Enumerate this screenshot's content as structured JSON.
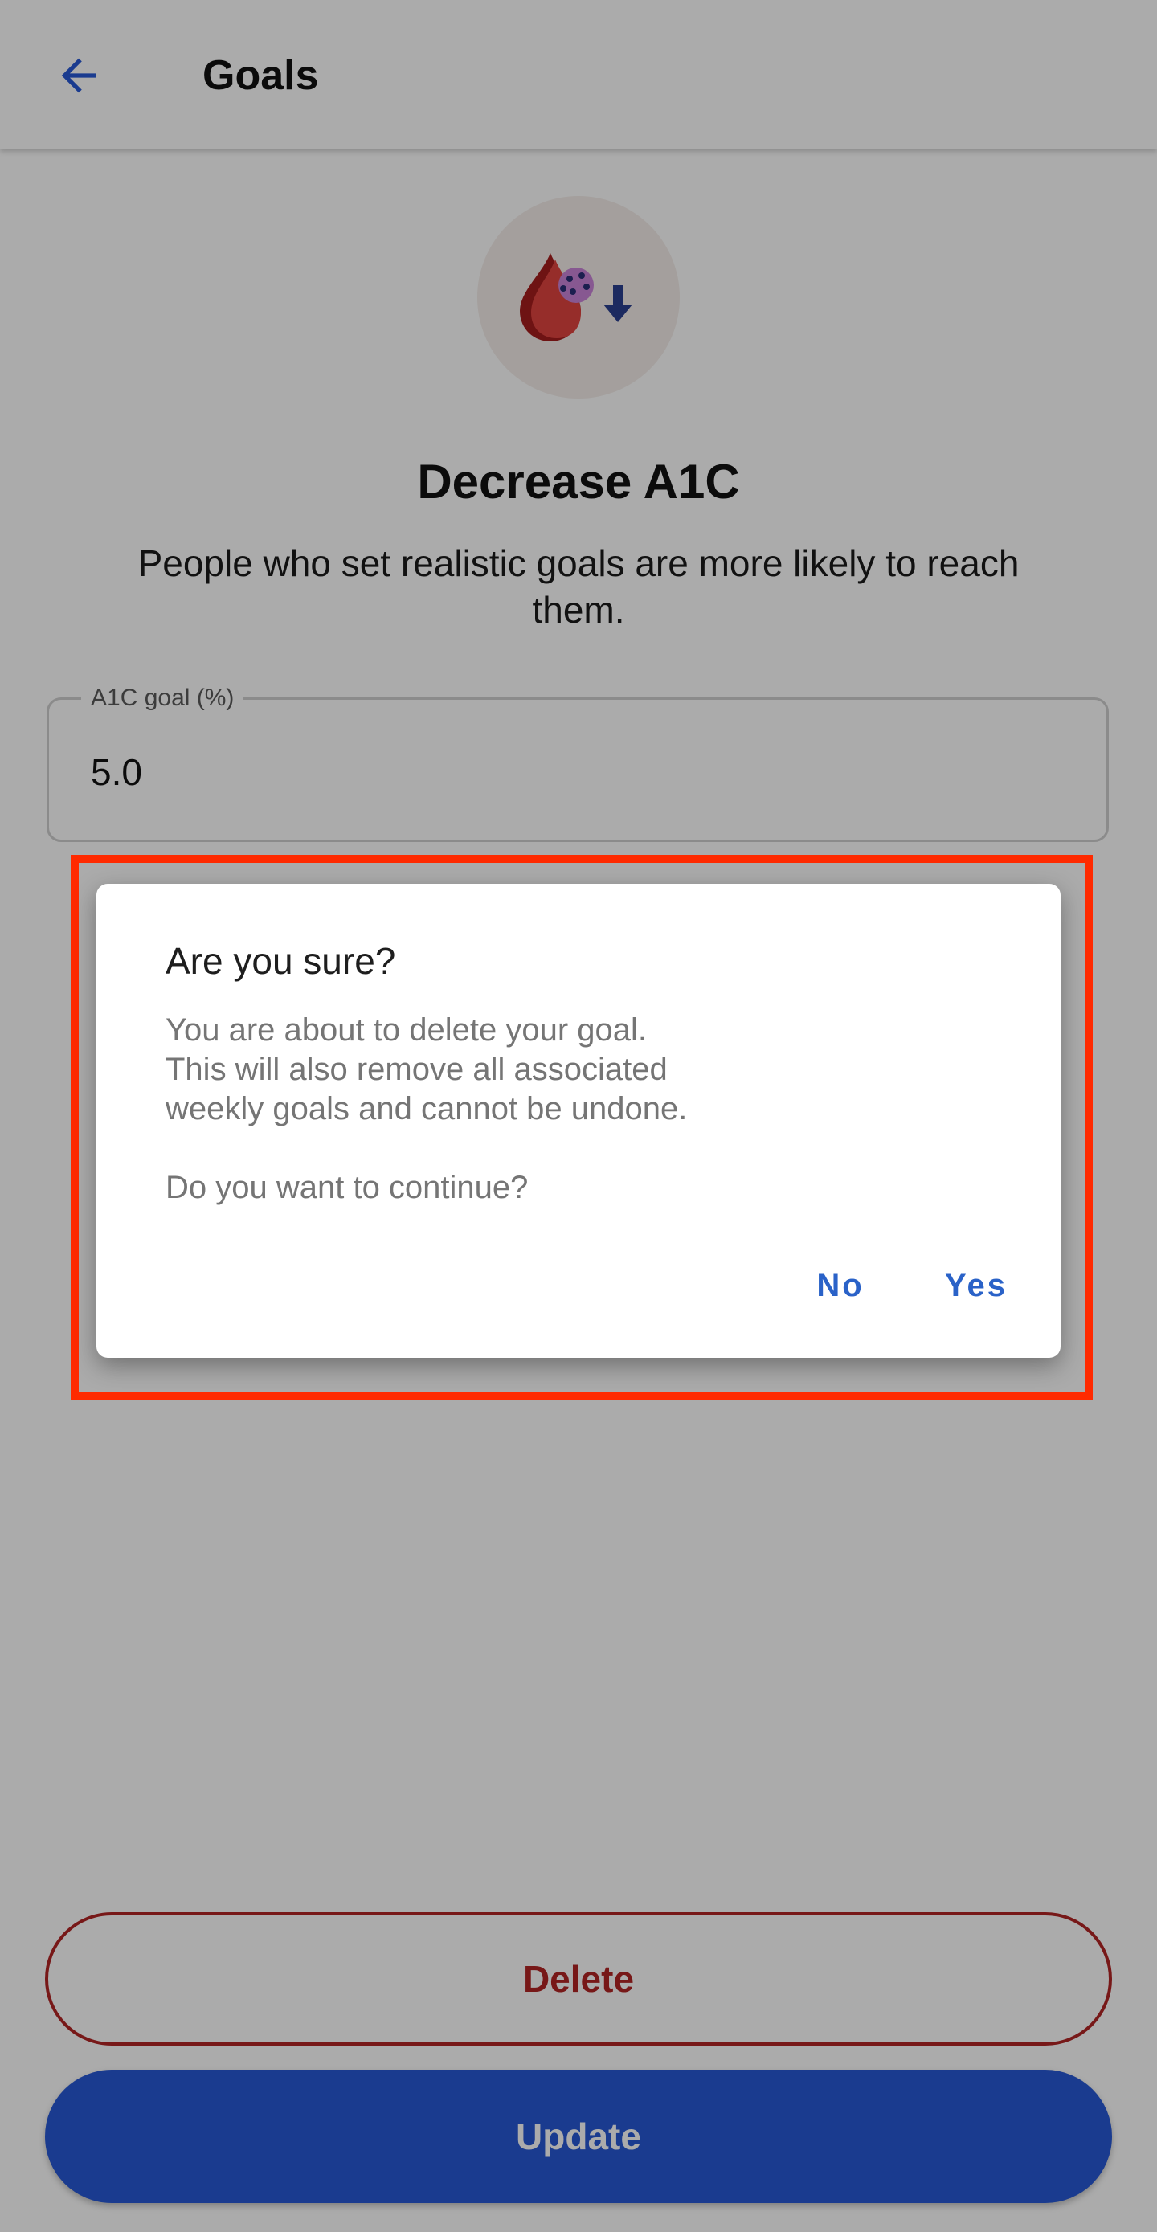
{
  "app_bar": {
    "title": "Goals",
    "back_icon": "arrow-back-icon"
  },
  "goal": {
    "icon": "blood-drop-decrease-icon",
    "title": "Decrease A1C",
    "description": "People who set realistic goals are more likely to reach them."
  },
  "field": {
    "label": "A1C goal (%)",
    "value": "5.0"
  },
  "buttons": {
    "delete_label": "Delete",
    "update_label": "Update"
  },
  "dialog": {
    "title": "Are you sure?",
    "body": "You are about to delete your goal.\nThis will also remove all associated\nweekly goals and cannot be undone.\n\nDo you want to continue?",
    "no_label": "No",
    "yes_label": "Yes"
  },
  "colors": {
    "primary": "#2759d5",
    "danger": "#b22525",
    "highlight": "#ff2a00",
    "dialog_action": "#2a62c8"
  }
}
